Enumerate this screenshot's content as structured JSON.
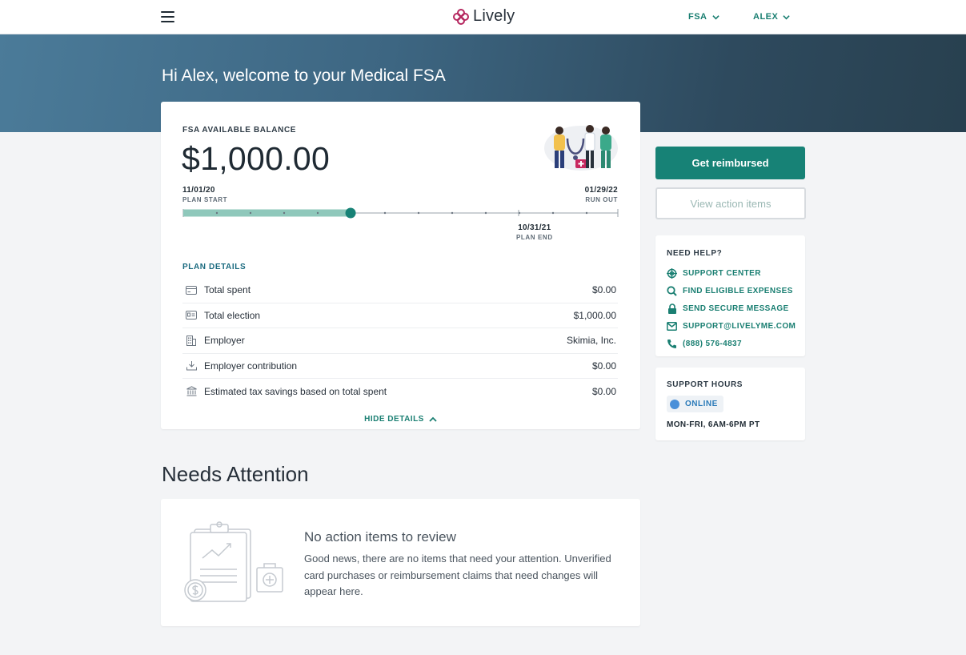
{
  "nav": {
    "logo_text": "Lively",
    "account_type": "FSA",
    "user_name": "ALEX"
  },
  "hero": {
    "title": "Hi Alex, welcome to your Medical FSA"
  },
  "balance": {
    "label": "FSA AVAILABLE BALANCE",
    "amount": "$1,000.00",
    "plan_start_date": "11/01/20",
    "plan_start_label": "PLAN START",
    "run_out_date": "01/29/22",
    "run_out_label": "RUN OUT",
    "plan_end_date": "10/31/21",
    "plan_end_label": "PLAN END",
    "progress_fraction": 0.385
  },
  "plan_details": {
    "label": "PLAN DETAILS",
    "rows": [
      {
        "icon": "credit-card-icon",
        "label": "Total spent",
        "value": "$0.00"
      },
      {
        "icon": "id-card-icon",
        "label": "Total election",
        "value": "$1,000.00"
      },
      {
        "icon": "building-icon",
        "label": "Employer",
        "value": "Skimia, Inc."
      },
      {
        "icon": "download-icon",
        "label": "Employer contribution",
        "value": "$0.00"
      },
      {
        "icon": "bank-icon",
        "label": "Estimated tax savings based on total spent",
        "value": "$0.00"
      }
    ],
    "hide_label": "HIDE DETAILS"
  },
  "actions": {
    "primary_label": "Get reimbursed",
    "secondary_label": "View action items"
  },
  "help": {
    "title": "NEED HELP?",
    "links": [
      {
        "icon": "support-icon",
        "label": "SUPPORT CENTER"
      },
      {
        "icon": "search-icon",
        "label": "FIND ELIGIBLE EXPENSES"
      },
      {
        "icon": "lock-icon",
        "label": "SEND SECURE MESSAGE"
      },
      {
        "icon": "mail-icon",
        "label": "SUPPORT@LIVELYME.COM"
      },
      {
        "icon": "phone-icon",
        "label": "(888) 576-4837"
      }
    ]
  },
  "support_hours": {
    "title": "SUPPORT HOURS",
    "status": "ONLINE",
    "hours": "MON-FRI, 6AM-6PM PT"
  },
  "needs_attention": {
    "title": "Needs Attention",
    "heading": "No action items to review",
    "body": "Good news, there are no items that need your attention. Unverified card purchases or reimbursement claims that need changes will appear here."
  },
  "colors": {
    "brand_teal": "#178276",
    "link_teal": "#1a7f72",
    "logo_magenta": "#b5275f",
    "hero_dark": "#28404f",
    "online_blue": "#4a90d9"
  }
}
